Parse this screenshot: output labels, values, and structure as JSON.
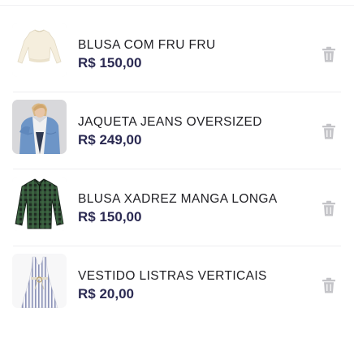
{
  "cart": {
    "items": [
      {
        "name": "BLUSA COM FRU FRU",
        "price": "R$ 150,00",
        "image": "cream-ruffle-blouse",
        "remove_icon": "trash-icon"
      },
      {
        "name": "JAQUETA JEANS OVERSIZED",
        "price": "R$ 249,00",
        "image": "oversized-denim-jacket",
        "remove_icon": "trash-icon"
      },
      {
        "name": "BLUSA XADREZ MANGA LONGA",
        "price": "R$ 150,00",
        "image": "green-plaid-long-sleeve-shirt",
        "remove_icon": "trash-icon"
      },
      {
        "name": "VESTIDO LISTRAS VERTICAIS",
        "price": "R$ 20,00",
        "image": "vertical-stripe-dress",
        "remove_icon": "trash-icon"
      }
    ]
  },
  "colors": {
    "price": "#2b2a52",
    "name": "#1f1f24",
    "icon": "#c4c4c8",
    "divider": "#eeeef0"
  }
}
